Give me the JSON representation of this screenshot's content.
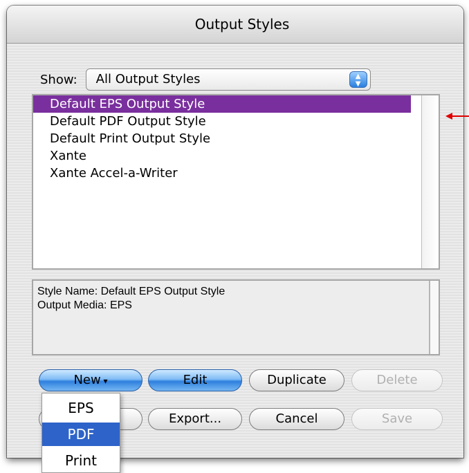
{
  "window": {
    "title": "Output Styles"
  },
  "show": {
    "label": "Show:",
    "selected": "All Output Styles"
  },
  "styles_list": {
    "items": [
      "Default EPS Output Style",
      "Default PDF Output Style",
      "Default Print Output Style",
      "Xante",
      "Xante Accel-a-Writer"
    ],
    "selected_index": 0
  },
  "description": {
    "line1": "Style Name: Default EPS Output Style",
    "line2": "Output Media: EPS"
  },
  "buttons": {
    "new": "New",
    "edit": "Edit",
    "duplicate": "Duplicate",
    "delete": "Delete",
    "export": "Export...",
    "cancel": "Cancel",
    "save": "Save"
  },
  "new_menu": {
    "items": [
      "EPS",
      "PDF",
      "Print"
    ],
    "highlighted": "PDF"
  },
  "colors": {
    "selection": "#7a2f9e",
    "menu_highlight": "#2e63c9",
    "annotation_arrow": "#e00000",
    "aqua_button": "#2e7fde"
  }
}
